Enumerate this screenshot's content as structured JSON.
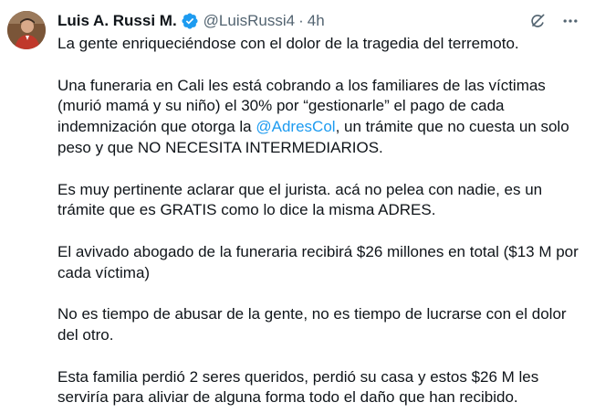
{
  "author": {
    "name": "Luis A. Russi M.",
    "handle": "@LuisRussi4",
    "separator": "·",
    "time": "4h",
    "verified_color": "#1d9bf0"
  },
  "icons": {
    "verified": "verified-badge-icon",
    "grok": "grok-icon",
    "more": "more-options-icon"
  },
  "tweet": {
    "p1": "La gente enriqueciéndose con el dolor de la tragedia del terremoto.",
    "p2_before": "Una funeraria en Cali les está cobrando a los familiares de las víctimas (murió mamá y su niño) el 30% por “gestionarle” el pago de cada indemnización que otorga la ",
    "p2_mention": "@AdresCol",
    "p2_after": ", un trámite que no cuesta un solo peso y que NO NECESITA INTERMEDIARIOS.",
    "p3": "Es muy pertinente aclarar que el jurista. acá no pelea con nadie, es un trámite que es GRATIS como lo dice la misma ADRES.",
    "p4": "El avivado abogado de la funeraria recibirá $26 millones en total ($13 M por cada víctima)",
    "p5": "No es tiempo de abusar de la gente, no es tiempo de lucrarse con el dolor del otro.",
    "p6": "Esta familia perdió 2 seres queridos, perdió su casa y estos $26 M les serviría para aliviar de alguna forma todo el daño que han recibido."
  },
  "colors": {
    "text": "#0f1419",
    "secondary": "#536471",
    "link": "#1d9bf0"
  }
}
